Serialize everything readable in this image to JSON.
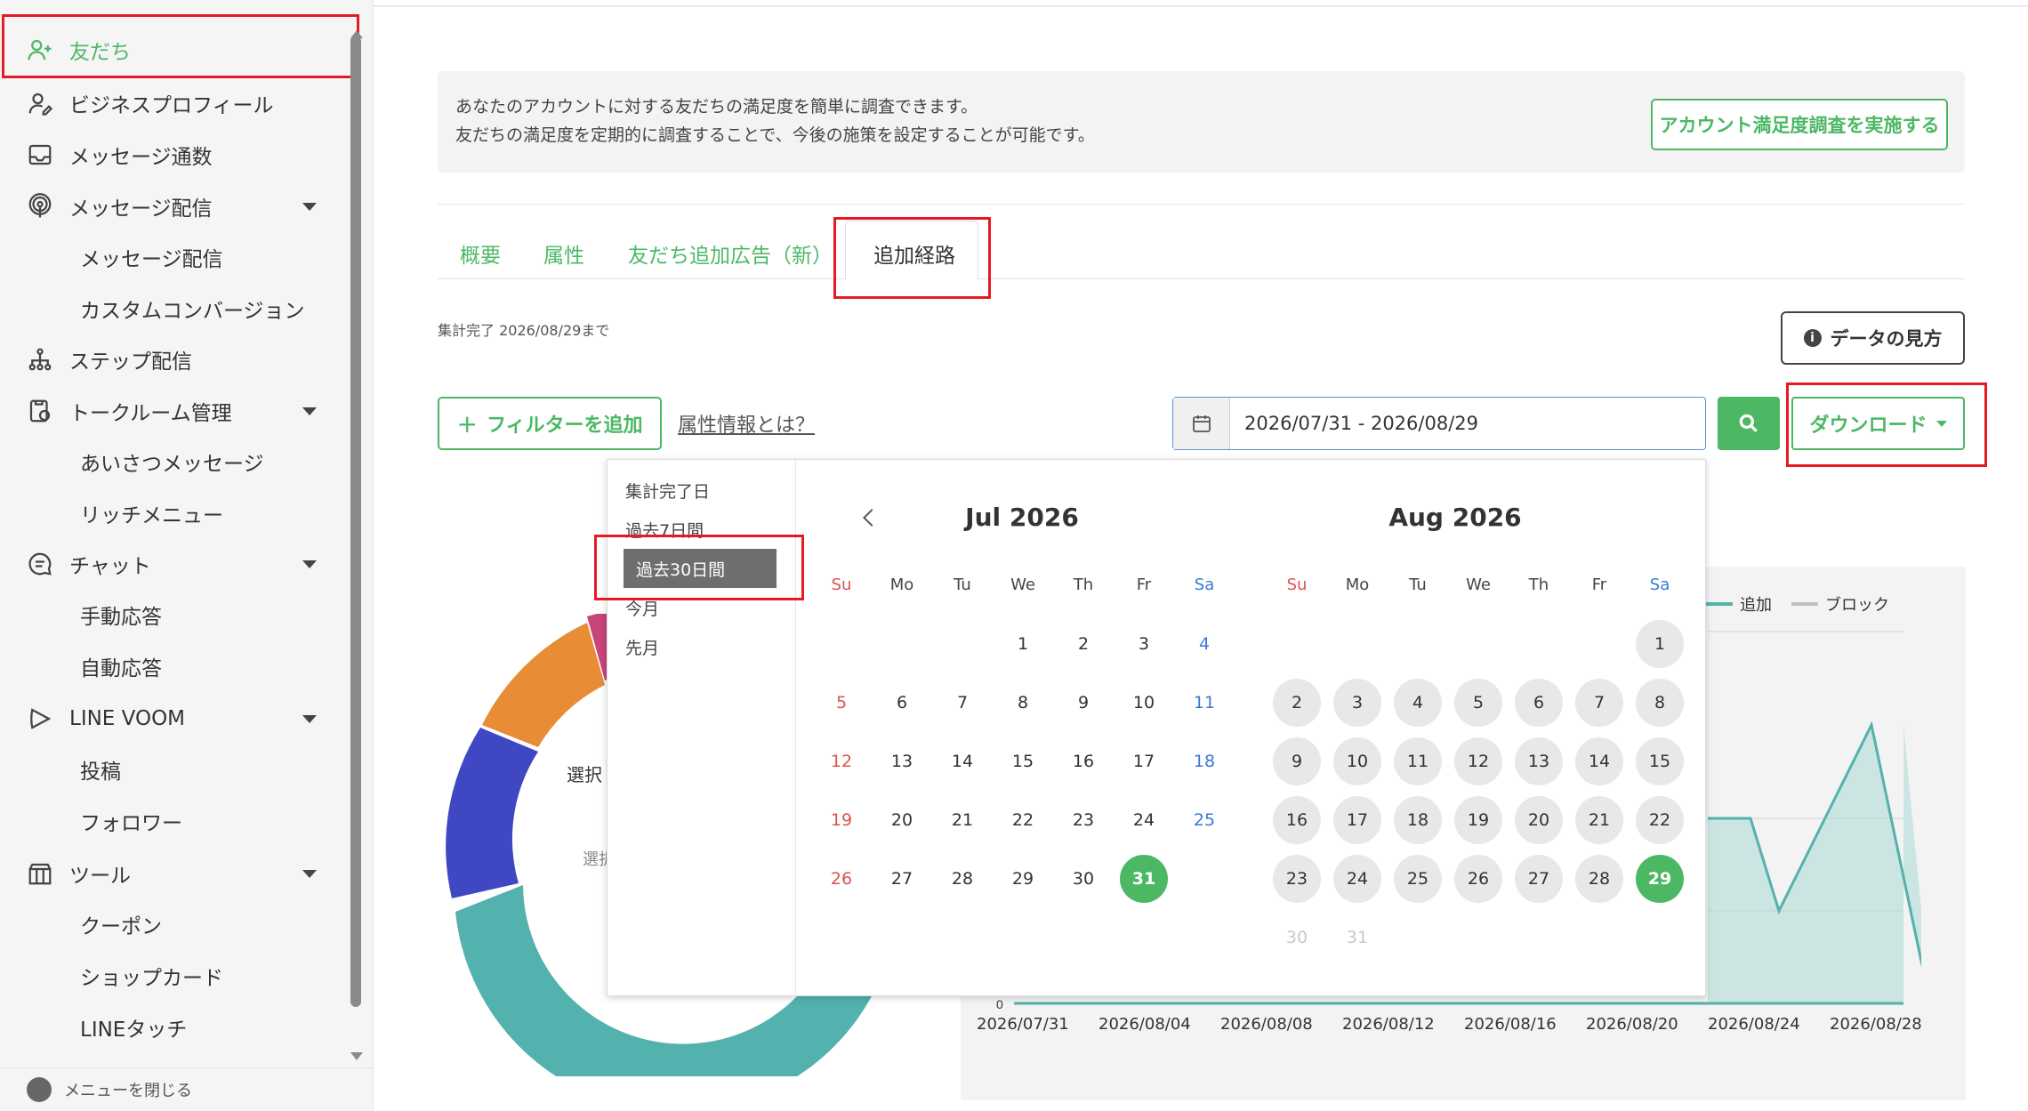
{
  "sidebar": {
    "items": [
      {
        "label": "友だち",
        "icon": "add-friend-icon"
      },
      {
        "label": "ビジネスプロフィール",
        "icon": "profile-icon"
      },
      {
        "label": "メッセージ通数",
        "icon": "inbox-icon"
      },
      {
        "label": "メッセージ配信",
        "icon": "broadcast-icon"
      },
      {
        "label": "メッセージ配信"
      },
      {
        "label": "カスタムコンバージョン"
      },
      {
        "label": "ステップ配信",
        "icon": "step-icon"
      },
      {
        "label": "トークルーム管理",
        "icon": "talkroom-icon"
      },
      {
        "label": "あいさつメッセージ"
      },
      {
        "label": "リッチメニュー"
      },
      {
        "label": "チャット",
        "icon": "chat-icon"
      },
      {
        "label": "手動応答"
      },
      {
        "label": "自動応答"
      },
      {
        "label": "LINE VOOM",
        "icon": "play-icon"
      },
      {
        "label": "投稿"
      },
      {
        "label": "フォロワー"
      },
      {
        "label": "ツール",
        "icon": "tool-icon"
      },
      {
        "label": "クーポン"
      },
      {
        "label": "ショップカード"
      },
      {
        "label": "LINEタッチ"
      }
    ],
    "footer": "メニューを閉じる"
  },
  "notice": {
    "line1": "あなたのアカウントに対する友だちの満足度を簡単に調査できます。",
    "line2": "友だちの満足度を定期的に調査することで、今後の施策を設定することが可能です。",
    "button": "アカウント満足度調査を実施する"
  },
  "tabs": [
    "概要",
    "属性",
    "友だち追加広告（新）",
    "追加経路"
  ],
  "status": "集計完了 2026/08/29まで",
  "help_button": "データの見方",
  "filter_button": "フィルターを追加",
  "attr_link": "属性情報とは？",
  "date_range": "2026/07/31 - 2026/08/29",
  "download_button": "ダウンロード",
  "picker": {
    "ranges": [
      "集計完了日",
      "過去7日間",
      "過去30日間",
      "今月",
      "先月"
    ],
    "selected_range": "過去30日間",
    "dow": [
      "Su",
      "Mo",
      "Tu",
      "We",
      "Th",
      "Fr",
      "Sa"
    ],
    "left_title": "Jul 2026",
    "right_title": "Aug 2026"
  },
  "chart_partial": {
    "donut_label": "選択",
    "donut_sub": "選択",
    "legend": [
      "追加",
      "ブロック"
    ],
    "y_zero": "0",
    "x_labels": [
      "2026/07/31",
      "2026/08/04",
      "2026/08/08",
      "2026/08/12",
      "2026/08/16",
      "2026/08/20",
      "2026/08/24",
      "2026/08/28"
    ],
    "colors": {
      "teal": "#53b2ad",
      "blue": "#3f47c2",
      "orange": "#e88c36",
      "pink": "#c8457c",
      "grey": "#c0c0c0"
    }
  }
}
